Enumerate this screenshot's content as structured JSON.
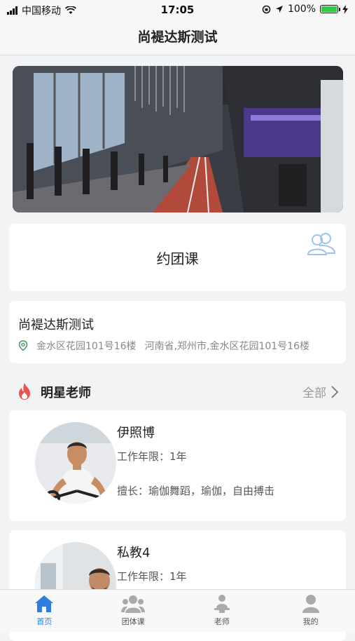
{
  "status_bar": {
    "carrier": "中国移动",
    "time": "17:05",
    "battery": "100%"
  },
  "header": {
    "title": "尚褆达斯测试"
  },
  "class_card": {
    "label": "约团课",
    "icon": "group-users-icon"
  },
  "store": {
    "name": "尚褆达斯测试",
    "address": "金水区花园101号16楼",
    "region": "河南省,郑州市,金水区花园101号16楼"
  },
  "section": {
    "title": "明星老师",
    "more": "全部"
  },
  "teachers": [
    {
      "name": "伊照博",
      "years": "工作年限：1年",
      "skills": "擅长：瑜伽舞蹈，瑜伽，自由搏击"
    },
    {
      "name": "私教4",
      "years": "工作年限：1年",
      "skills": ""
    }
  ],
  "tabs": [
    {
      "label": "首页",
      "icon": "home-icon",
      "active": true
    },
    {
      "label": "团体课",
      "icon": "group-class-icon",
      "active": false
    },
    {
      "label": "老师",
      "icon": "teacher-icon",
      "active": false
    },
    {
      "label": "我的",
      "icon": "profile-icon",
      "active": false
    }
  ],
  "colors": {
    "accent": "#2f7de1",
    "flame": "#e8554e"
  }
}
